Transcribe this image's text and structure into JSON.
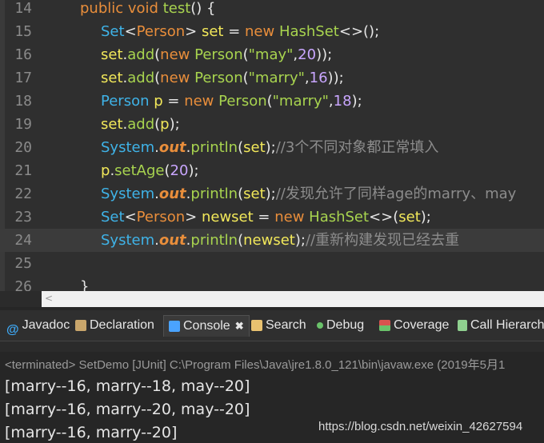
{
  "editor": {
    "line_numbers": [
      "14",
      "15",
      "16",
      "17",
      "18",
      "19",
      "20",
      "21",
      "22",
      "23",
      "24",
      "25",
      "26"
    ],
    "lines": [
      [
        {
          "t": "public void ",
          "c": "kw"
        },
        {
          "t": "test",
          "c": "fn"
        },
        {
          "t": "() {",
          "c": "plain"
        }
      ],
      [
        {
          "t": "Set",
          "c": "type"
        },
        {
          "t": "<",
          "c": "plain"
        },
        {
          "t": "Person",
          "c": "gen"
        },
        {
          "t": "> ",
          "c": "plain"
        },
        {
          "t": "set",
          "c": "var"
        },
        {
          "t": " = ",
          "c": "plain"
        },
        {
          "t": "new ",
          "c": "kw"
        },
        {
          "t": "HashSet",
          "c": "fn"
        },
        {
          "t": "<>();",
          "c": "plain"
        }
      ],
      [
        {
          "t": "set",
          "c": "var"
        },
        {
          "t": ".",
          "c": "plain"
        },
        {
          "t": "add",
          "c": "fn"
        },
        {
          "t": "(",
          "c": "plain"
        },
        {
          "t": "new ",
          "c": "kw"
        },
        {
          "t": "Person",
          "c": "fn"
        },
        {
          "t": "(",
          "c": "plain"
        },
        {
          "t": "\"may\"",
          "c": "str"
        },
        {
          "t": ",",
          "c": "plain"
        },
        {
          "t": "20",
          "c": "num"
        },
        {
          "t": "));",
          "c": "plain"
        }
      ],
      [
        {
          "t": "set",
          "c": "var"
        },
        {
          "t": ".",
          "c": "plain"
        },
        {
          "t": "add",
          "c": "fn"
        },
        {
          "t": "(",
          "c": "plain"
        },
        {
          "t": "new ",
          "c": "kw"
        },
        {
          "t": "Person",
          "c": "fn"
        },
        {
          "t": "(",
          "c": "plain"
        },
        {
          "t": "\"marry\"",
          "c": "str"
        },
        {
          "t": ",",
          "c": "plain"
        },
        {
          "t": "16",
          "c": "num"
        },
        {
          "t": "));",
          "c": "plain"
        }
      ],
      [
        {
          "t": "Person ",
          "c": "type"
        },
        {
          "t": "p",
          "c": "var"
        },
        {
          "t": " = ",
          "c": "plain"
        },
        {
          "t": "new ",
          "c": "kw"
        },
        {
          "t": "Person",
          "c": "fn"
        },
        {
          "t": "(",
          "c": "plain"
        },
        {
          "t": "\"marry\"",
          "c": "str"
        },
        {
          "t": ",",
          "c": "plain"
        },
        {
          "t": "18",
          "c": "num"
        },
        {
          "t": ");",
          "c": "plain"
        }
      ],
      [
        {
          "t": "set",
          "c": "var"
        },
        {
          "t": ".",
          "c": "plain"
        },
        {
          "t": "add",
          "c": "fn"
        },
        {
          "t": "(",
          "c": "plain"
        },
        {
          "t": "p",
          "c": "var"
        },
        {
          "t": ");",
          "c": "plain"
        }
      ],
      [
        {
          "t": "System",
          "c": "type"
        },
        {
          "t": ".",
          "c": "plain"
        },
        {
          "t": "out",
          "c": "field"
        },
        {
          "t": ".",
          "c": "plain"
        },
        {
          "t": "println",
          "c": "fn"
        },
        {
          "t": "(",
          "c": "plain"
        },
        {
          "t": "set",
          "c": "var"
        },
        {
          "t": ");",
          "c": "plain"
        },
        {
          "t": "//3个不同对象都正常填入",
          "c": "cmt"
        }
      ],
      [
        {
          "t": "p",
          "c": "var"
        },
        {
          "t": ".",
          "c": "plain"
        },
        {
          "t": "setAge",
          "c": "fn"
        },
        {
          "t": "(",
          "c": "plain"
        },
        {
          "t": "20",
          "c": "num"
        },
        {
          "t": ");",
          "c": "plain"
        }
      ],
      [
        {
          "t": "System",
          "c": "type"
        },
        {
          "t": ".",
          "c": "plain"
        },
        {
          "t": "out",
          "c": "field"
        },
        {
          "t": ".",
          "c": "plain"
        },
        {
          "t": "println",
          "c": "fn"
        },
        {
          "t": "(",
          "c": "plain"
        },
        {
          "t": "set",
          "c": "var"
        },
        {
          "t": ");",
          "c": "plain"
        },
        {
          "t": "//发现允许了同样age的marry、may",
          "c": "cmt"
        }
      ],
      [
        {
          "t": "Set",
          "c": "type"
        },
        {
          "t": "<",
          "c": "plain"
        },
        {
          "t": "Person",
          "c": "gen"
        },
        {
          "t": "> ",
          "c": "plain"
        },
        {
          "t": "newset",
          "c": "var"
        },
        {
          "t": " = ",
          "c": "plain"
        },
        {
          "t": "new ",
          "c": "kw"
        },
        {
          "t": "HashSet",
          "c": "fn"
        },
        {
          "t": "<>(",
          "c": "plain"
        },
        {
          "t": "set",
          "c": "var"
        },
        {
          "t": ");",
          "c": "plain"
        }
      ],
      [
        {
          "t": "System",
          "c": "type"
        },
        {
          "t": ".",
          "c": "plain"
        },
        {
          "t": "out",
          "c": "field"
        },
        {
          "t": ".",
          "c": "plain"
        },
        {
          "t": "println",
          "c": "fn"
        },
        {
          "t": "(",
          "c": "plain"
        },
        {
          "t": "newset",
          "c": "var"
        },
        {
          "t": ");",
          "c": "plain"
        },
        {
          "t": "//重新构建发现已经去重",
          "c": "cmt"
        }
      ],
      [],
      [
        {
          "t": "}",
          "c": "plain"
        }
      ]
    ]
  },
  "tabs": [
    {
      "label": "Javadoc",
      "icon": "at-icon",
      "color": "#3fa9f5"
    },
    {
      "label": "Declaration",
      "icon": "declaration-icon",
      "color": "#c9a66b"
    },
    {
      "label": "Console",
      "icon": "console-icon",
      "color": "#4aa3ff"
    },
    {
      "label": "Search",
      "icon": "search-icon",
      "color": "#e8c170"
    },
    {
      "label": "Debug",
      "icon": "debug-icon",
      "color": "#6ac26a"
    },
    {
      "label": "Coverage",
      "icon": "coverage-icon",
      "color": "#d9534f"
    },
    {
      "label": "Call Hierarch",
      "icon": "call-hierarchy-icon",
      "color": "#8fd18f"
    }
  ],
  "console": {
    "terminated": "<terminated> SetDemo [JUnit] C:\\Program Files\\Java\\jre1.8.0_121\\bin\\javaw.exe (2019年5月1",
    "output": [
      "[marry--16, marry--18, may--20]",
      "[marry--16, marry--20, may--20]",
      "[marry--16, marry--20]"
    ]
  },
  "watermark": "https://blog.csdn.net/weixin_42627594"
}
